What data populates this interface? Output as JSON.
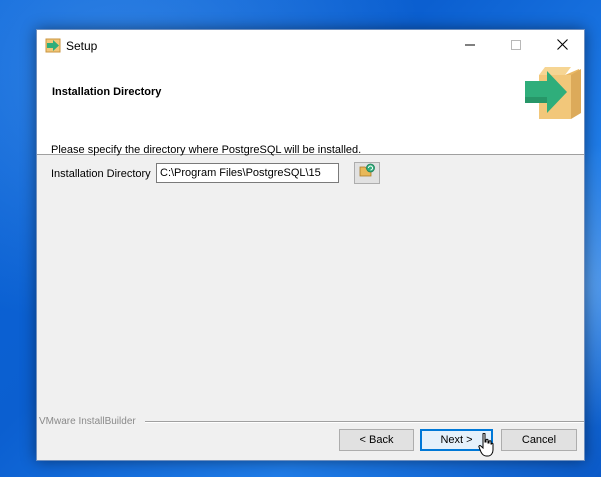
{
  "window": {
    "title": "Setup",
    "icons": {
      "app": "setup-arrow-icon",
      "minimize": "minimize-icon",
      "maximize": "maximize-icon",
      "close": "close-icon"
    }
  },
  "header": {
    "title": "Installation Directory",
    "art": "box-arrow-icon"
  },
  "body": {
    "description": "Please specify the directory where PostgreSQL will be installed.",
    "dir_label": "Installation Directory",
    "dir_value": "C:\\Program Files\\PostgreSQL\\15",
    "browse_icon": "folder-browse-icon"
  },
  "footer": {
    "brand": "VMware InstallBuilder",
    "back_label": "< Back",
    "next_label": "Next >",
    "cancel_label": "Cancel"
  },
  "colors": {
    "accent": "#0078d7",
    "desktop": "#0b5fd0",
    "window_bg": "#f0f0f0",
    "arrow_green": "#2fae7b",
    "box_tan": "#f2c77a"
  }
}
